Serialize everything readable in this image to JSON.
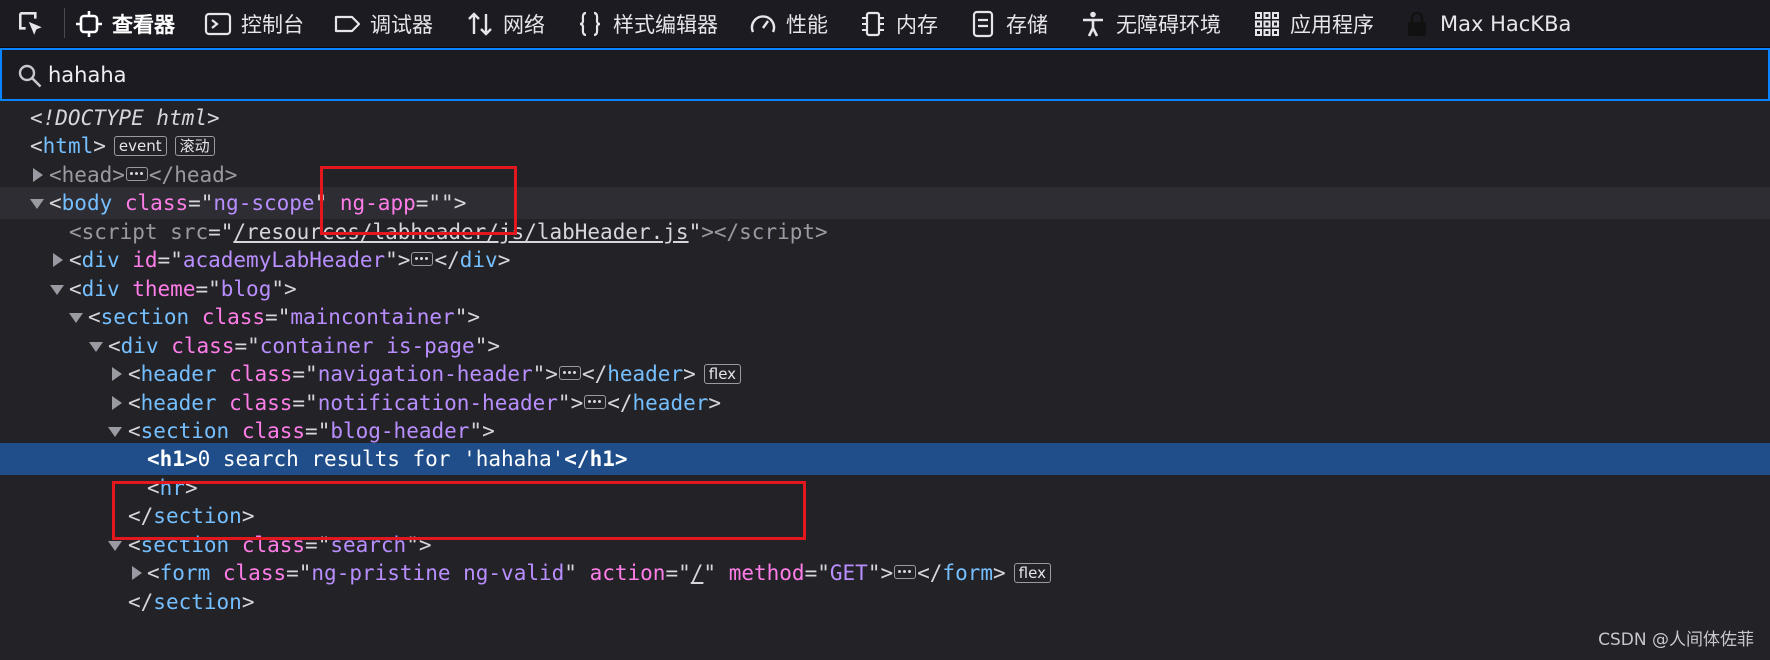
{
  "toolbar": {
    "tabs": [
      {
        "label": "查看器",
        "icon": "inspector-icon",
        "active": true
      },
      {
        "label": "控制台",
        "icon": "console-icon"
      },
      {
        "label": "调试器",
        "icon": "debugger-icon"
      },
      {
        "label": "网络",
        "icon": "network-icon"
      },
      {
        "label": "样式编辑器",
        "icon": "style-editor-icon"
      },
      {
        "label": "性能",
        "icon": "performance-icon"
      },
      {
        "label": "内存",
        "icon": "memory-icon"
      },
      {
        "label": "存储",
        "icon": "storage-icon"
      },
      {
        "label": "无障碍环境",
        "icon": "accessibility-icon"
      },
      {
        "label": "应用程序",
        "icon": "application-icon"
      },
      {
        "label": "Max HacKBa",
        "icon": "extension-icon"
      }
    ]
  },
  "search": {
    "value": "hahaha"
  },
  "tree": {
    "doctype": "<!DOCTYPE html>",
    "html": {
      "tag": "html",
      "badges": [
        "event",
        "滚动"
      ]
    },
    "head": {
      "tag": "head"
    },
    "body": {
      "tag": "body",
      "attr1": "class",
      "val1": "ng-scope",
      "attr2": "ng-app",
      "val2": ""
    },
    "script": {
      "tag": "script",
      "attr": "src",
      "val": "/resources/labheader/js/labHeader.js"
    },
    "div_header": {
      "tag": "div",
      "attr": "id",
      "val": "academyLabHeader"
    },
    "div_theme": {
      "tag": "div",
      "attr": "theme",
      "val": "blog"
    },
    "section_main": {
      "tag": "section",
      "attr": "class",
      "val": "maincontainer"
    },
    "div_container": {
      "tag": "div",
      "attr": "class",
      "val": "container is-page"
    },
    "header_nav": {
      "tag": "header",
      "attr": "class",
      "val": "navigation-header",
      "badge": "flex"
    },
    "header_notif": {
      "tag": "header",
      "attr": "class",
      "val": "notification-header"
    },
    "section_blog": {
      "tag": "section",
      "attr": "class",
      "val": "blog-header"
    },
    "h1": {
      "tag": "h1",
      "text": "0 search results for 'hahaha'"
    },
    "hr": {
      "tag": "hr"
    },
    "section_close": {
      "tag": "section"
    },
    "section_search": {
      "tag": "section",
      "attr": "class",
      "val": "search"
    },
    "form": {
      "tag": "form",
      "attr1": "class",
      "val1": "ng-pristine ng-valid",
      "attr2": "action",
      "val2": "/",
      "attr3": "method",
      "val3": "GET",
      "badge": "flex"
    }
  },
  "watermark": "CSDN @人间体佐菲",
  "colors": {
    "tag": "#75bfff",
    "attr": "#ff7de9",
    "value": "#b98eff",
    "selected_row": "#204e8a",
    "annotation": "#e3181f"
  }
}
